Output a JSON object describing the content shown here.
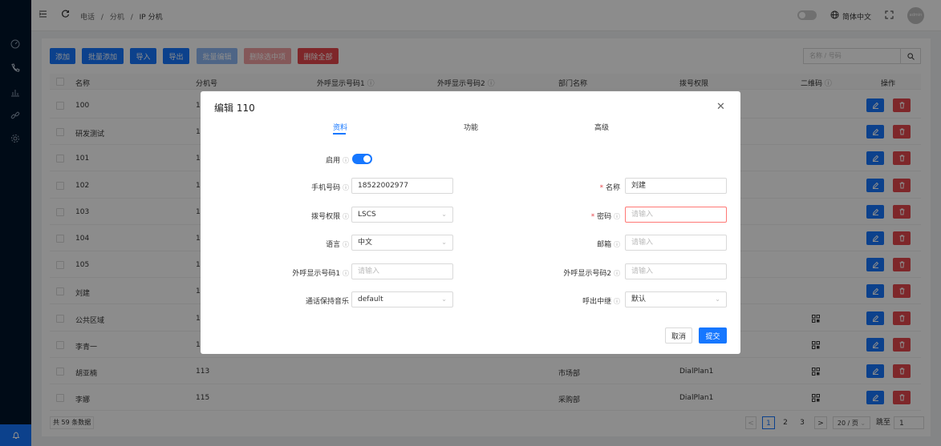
{
  "breadcrumb": {
    "items": [
      "电话",
      "分机",
      "IP 分机"
    ],
    "separator": "/"
  },
  "header": {
    "language": "简体中文",
    "avatar_text": "admin"
  },
  "toolbar": {
    "add": "添加",
    "batch_add": "批量添加",
    "import": "导入",
    "export": "导出",
    "batch_edit": "批量编辑",
    "delete_selected": "删除选中项",
    "delete_all": "删除全部"
  },
  "search": {
    "placeholder": "名称 / 号码"
  },
  "table": {
    "headers": {
      "name": "名称",
      "ext": "分机号",
      "caller1": "外呼显示号码1",
      "caller2": "外呼显示号码2",
      "dept": "部门名称",
      "perm": "拨号权限",
      "qr": "二维码",
      "ops": "操作"
    },
    "rows": [
      {
        "name": "100",
        "ext": "1"
      },
      {
        "name": "研发测试",
        "ext": "1"
      },
      {
        "name": "101",
        "ext": "1"
      },
      {
        "name": "102",
        "ext": "1"
      },
      {
        "name": "103",
        "ext": "1"
      },
      {
        "name": "104",
        "ext": "1"
      },
      {
        "name": "105",
        "ext": "1"
      },
      {
        "name": "刘建",
        "ext": "1"
      },
      {
        "name": "公共区域",
        "ext": "1"
      },
      {
        "name": "李青一",
        "ext": "1"
      },
      {
        "name": "胡亚楠",
        "ext": "113",
        "dept": "市场部",
        "perm": "DialPlan1"
      },
      {
        "name": "李娜",
        "ext": "115",
        "dept": "采购部",
        "perm": "DialPlan1"
      }
    ]
  },
  "footer": {
    "total": "共 59 条数据",
    "pages": [
      "1",
      "2",
      "3"
    ],
    "page_size": "20 / 页",
    "goto_label": "跳至",
    "goto_value": "1",
    "prev": "<",
    "next": ">"
  },
  "modal": {
    "title": "编辑 110",
    "tabs": [
      "资料",
      "功能",
      "高级"
    ],
    "fields": {
      "enable_label": "启用",
      "mobile_label": "手机号码",
      "mobile_value": "18522002977",
      "dial_perm_label": "拨号权限",
      "dial_perm_value": "LSCS",
      "language_label": "语言",
      "language_value": "中文",
      "caller1_label": "外呼显示号码1",
      "caller1_placeholder": "请输入",
      "hold_music_label": "通话保持音乐",
      "hold_music_value": "default",
      "name_label": "名称",
      "name_value": "刘建",
      "password_label": "密码",
      "password_placeholder": "请输入",
      "email_label": "邮箱",
      "email_placeholder": "请输入",
      "caller2_label": "外呼显示号码2",
      "caller2_placeholder": "请输入",
      "trunk_label": "呼出中继",
      "trunk_value": "默认"
    },
    "cancel": "取消",
    "submit": "提交"
  },
  "colors": {
    "primary": "#1677ff",
    "danger": "#e5484d",
    "sidebar": "#00152a"
  }
}
